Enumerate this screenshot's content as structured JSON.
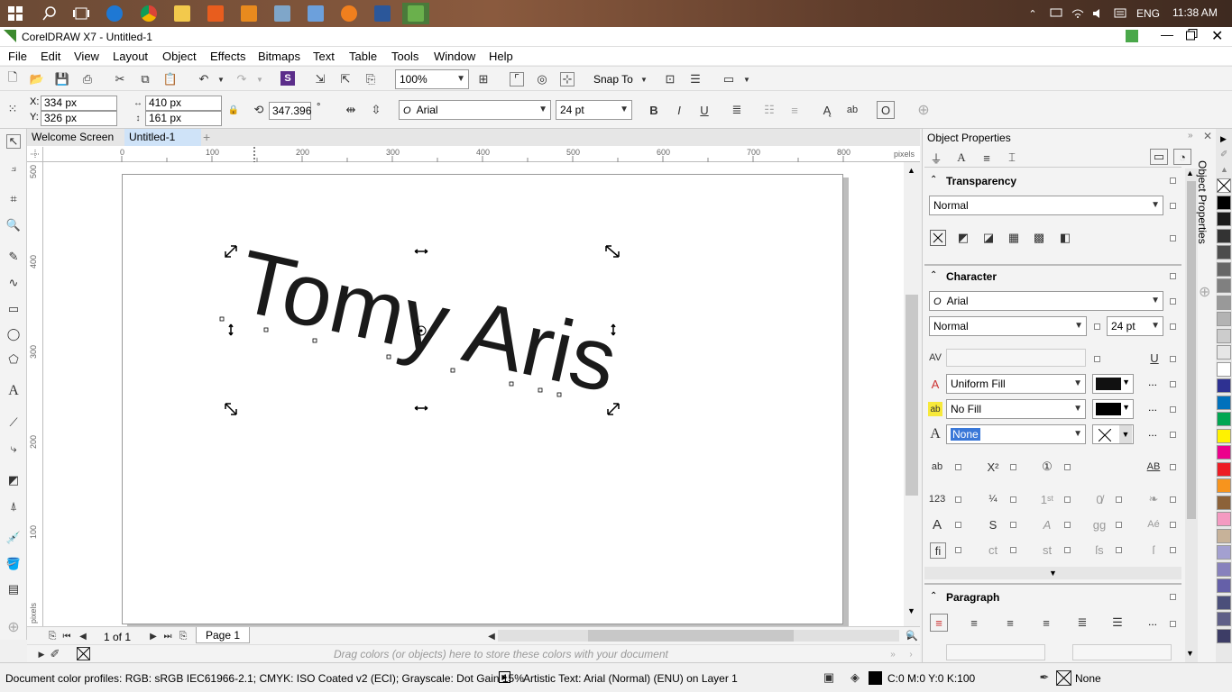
{
  "taskbar": {
    "time": "11:38 AM",
    "language": "ENG"
  },
  "window": {
    "title": "CorelDRAW X7 - Untitled-1"
  },
  "menu": [
    "File",
    "Edit",
    "View",
    "Layout",
    "Object",
    "Effects",
    "Bitmaps",
    "Text",
    "Table",
    "Tools",
    "Window",
    "Help"
  ],
  "toolbar": {
    "zoom": "100%",
    "snap_to": "Snap To"
  },
  "propertybar": {
    "x": "334 px",
    "y": "326 px",
    "width": "410 px",
    "height": "161 px",
    "rotation": "347.396",
    "degree": "°",
    "x_label": "X:",
    "y_label": "Y:",
    "font": "Arial",
    "font_size": "24 pt"
  },
  "doc_tabs": {
    "welcome": "Welcome Screen",
    "untitled": "Untitled-1"
  },
  "ruler": {
    "unit": "pixels",
    "h_labels": [
      "0",
      "100",
      "200",
      "300",
      "400",
      "500",
      "600",
      "700",
      "800"
    ],
    "v_labels": [
      "500",
      "400",
      "300",
      "200",
      "100"
    ],
    "v_unit": "pixels"
  },
  "canvas": {
    "text": "Tomy Aris",
    "font": "Arial"
  },
  "page_nav": {
    "counter": "1 of 1",
    "page_tab": "Page 1"
  },
  "palette_hint": "Drag colors (or objects) here to store these colors with your document",
  "status": {
    "color_profiles": "Document color profiles: RGB: sRGB IEC61966-2.1; CMYK: ISO Coated v2 (ECI); Grayscale: Dot Gain 15%",
    "object_info": "Artistic Text: Arial (Normal) (ENU) on Layer 1",
    "fill_value": "C:0 M:0 Y:0 K:100",
    "outline_value": "None"
  },
  "docker": {
    "title": "Object Properties",
    "transparency_title": "Transparency",
    "transparency_mode": "Normal",
    "character_title": "Character",
    "char_font": "Arial",
    "char_style": "Normal",
    "char_size": "24 pt",
    "fill_type": "Uniform Fill",
    "bg_fill_type": "No Fill",
    "outline_type": "None",
    "paragraph_title": "Paragraph",
    "more": "...",
    "tab_label": "Object Properties"
  },
  "colors": {
    "accent": "#4a8c3a",
    "selection": "#3a78d8",
    "palette": [
      "#ffffff",
      "#000000",
      "#1a1a1a",
      "#333333",
      "#4d4d4d",
      "#666666",
      "#808080",
      "#999999",
      "#b3b3b3",
      "#cccccc",
      "#e6e6e6",
      "#ffffff",
      "#2e3192",
      "#0071bc",
      "#00a651",
      "#fff200",
      "#ec008c",
      "#ed1c24",
      "#f7941d",
      "#8c6239",
      "#f49ac1",
      "#c7b299",
      "#a3a0d0",
      "#8781bd",
      "#6560a8",
      "#4b4f7a",
      "#5f5f88",
      "#3d3d66"
    ]
  }
}
